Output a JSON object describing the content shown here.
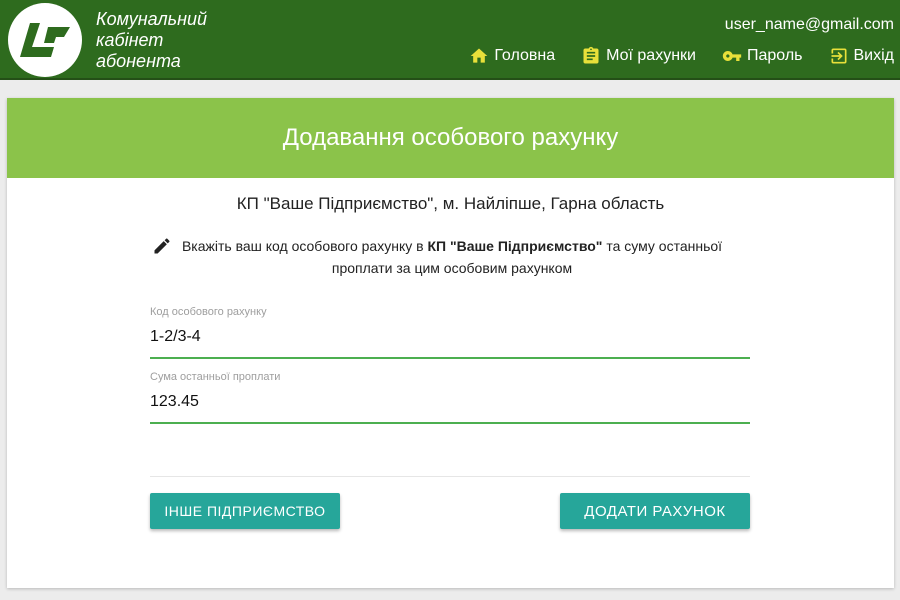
{
  "header": {
    "app_title_lines": [
      "Комунальний",
      "кабінет",
      "абонента"
    ],
    "user_email": "user_name@gmail.com",
    "nav": [
      {
        "label": "Головна",
        "icon": "home-icon"
      },
      {
        "label": "Мої рахунки",
        "icon": "clipboard-icon"
      },
      {
        "label": "Пароль",
        "icon": "key-icon"
      },
      {
        "label": "Вихід",
        "icon": "logout-icon"
      }
    ]
  },
  "card": {
    "title": "Додавання особового рахунку",
    "company": "КП \"Ваше Підприємство\", м. Найліпше, Гарна область",
    "hint": {
      "before": "Вкажіть ваш код особового рахунку в ",
      "bold": "КП \"Ваше Підприємство\"",
      "after": " та суму останньої проплати за цим особовим рахунком"
    },
    "fields": {
      "account_label": "Код особового рахунку",
      "account_value": "1-2/3-4",
      "amount_label": "Сума останньої проплати",
      "amount_value": "123.45"
    },
    "buttons": {
      "other": "ІНШЕ ПІДПРИЄМСТВО",
      "add": "ДОДАТИ РАХУНОК"
    }
  },
  "colors": {
    "header_bg": "#2e6b1e",
    "card_header_bg": "#8bc34a",
    "button_bg": "#26a69a",
    "input_underline": "#4caf50",
    "nav_icon": "#e8e03a"
  }
}
